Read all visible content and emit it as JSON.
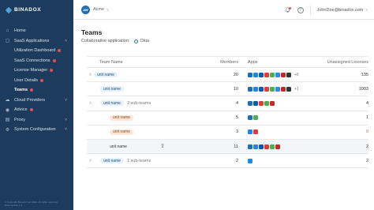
{
  "sidebar": {
    "logo": "BINADOX",
    "items": [
      {
        "label": "Home",
        "icon": "home-icon"
      },
      {
        "label": "SaaS Applications",
        "icon": "apps-icon"
      },
      {
        "label": "Utilization Dashboard"
      },
      {
        "label": "SaaS Connections"
      },
      {
        "label": "License Manager"
      },
      {
        "label": "User Details"
      },
      {
        "label": "Teams"
      },
      {
        "label": "Cloud Providers",
        "icon": "cloud-icon"
      },
      {
        "label": "Advice",
        "icon": "advice-icon"
      },
      {
        "label": "Proxy",
        "icon": "proxy-icon"
      },
      {
        "label": "System Configuration",
        "icon": "gear-icon"
      }
    ],
    "footer": [
      "© Copyright Binadox Ltd. 2020. All rights reserved.",
      "Build version 1.0"
    ]
  },
  "topbar": {
    "account_initials": "AW",
    "account_name": "Acme",
    "user_email": "JohnDoe@binadox.com"
  },
  "page": {
    "title": "Teams",
    "collab_label": "Collaborative application:",
    "collab_app": "Okta"
  },
  "table": {
    "headers": {
      "name": "Team Name",
      "members": "Members",
      "apps": "Apps",
      "unassigned": "Unassigned Licenses"
    },
    "rows": [
      {
        "exp": "^",
        "name": "unit name",
        "sub": "",
        "members": "20",
        "extra": "+6",
        "unassigned": "135",
        "style": "blue",
        "apps": [
          "#1f6fb2",
          "#1e88e5",
          "#0b5cad",
          "#e53935",
          "#4caf50",
          "#2d8cf0",
          "#c62828",
          "#333333"
        ]
      },
      {
        "exp": "",
        "name": "unit name",
        "sub": "",
        "members": "10",
        "extra": "+1",
        "unassigned": "1003",
        "style": "blue",
        "apps": [
          "#1f6fb2",
          "#1e88e5",
          "#0b5cad",
          "#e53935",
          "#4caf50",
          "#2d8cf0",
          "#c62828",
          "#333333"
        ]
      },
      {
        "exp": "^",
        "name": "unit name",
        "sub": "2 sub-teams",
        "members": "4",
        "extra": "",
        "unassigned": "4",
        "style": "blue",
        "apps": [
          "#1f6fb2",
          "#0b5cad",
          "#e53935",
          "#4caf50",
          "#c62828"
        ]
      },
      {
        "exp": "",
        "name": "unit name",
        "sub": "",
        "members": "5",
        "extra": "",
        "unassigned": "1",
        "style": "orange",
        "apps": [
          "#1f6fb2",
          "#4caf50"
        ]
      },
      {
        "exp": "",
        "name": "unit name",
        "sub": "",
        "members": "3",
        "extra": "",
        "unassigned": "0",
        "style": "orange",
        "apps": [
          "#1e88e5",
          "#e53935"
        ]
      },
      {
        "exp": "",
        "name": "unit name",
        "sub": "",
        "members": "11",
        "extra": "",
        "unassigned": "2",
        "style": "plain",
        "apps": [
          "#1f6fb2",
          "#1e88e5",
          "#0b5cad",
          "#e53935",
          "#4caf50",
          "#c62828"
        ]
      },
      {
        "exp": "v",
        "name": "unit name",
        "sub": "1 sub-teams",
        "members": "2",
        "extra": "",
        "unassigned": "2",
        "style": "blue",
        "apps": [
          "#1e88e5"
        ]
      }
    ]
  },
  "colors": {
    "sidebar": "#1d3b5c",
    "accent": "#1f6fb2",
    "alert": "#e94b5b"
  }
}
